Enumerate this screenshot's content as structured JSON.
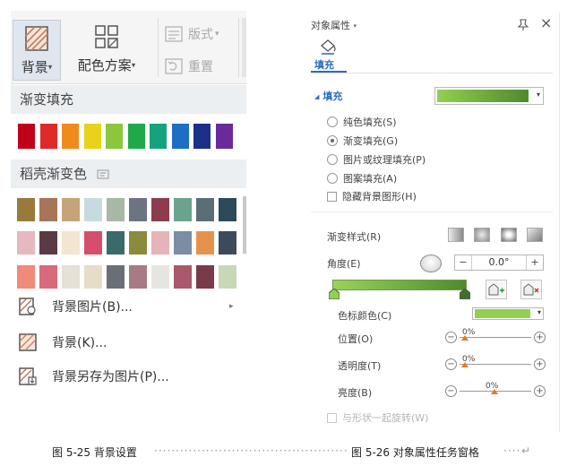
{
  "ribbon": {
    "background_btn": {
      "label": "背景",
      "icon": "background-hatch-icon"
    },
    "color_scheme_btn": {
      "label": "配色方案",
      "icon": "color-scheme-grid-icon"
    },
    "layout_btn": {
      "label": "版式",
      "icon": "layout-icon"
    },
    "reset_btn": {
      "label": "重置",
      "icon": "reset-icon"
    }
  },
  "gradient_section": {
    "title": "渐变填充",
    "colors": [
      "#c0001a",
      "#e02a2a",
      "#f08a1a",
      "#e8d21a",
      "#8cc63c",
      "#1faa4a",
      "#14a37c",
      "#1c6fc4",
      "#1d2f86",
      "#6a2a9c"
    ]
  },
  "shell_section": {
    "title": "稻壳渐变色",
    "row1": [
      "#9a7a3c",
      "#a8745a",
      "#c6a47a",
      "#c6dbe0",
      "#a8b8a6",
      "#6c7484",
      "#8c3c4a",
      "#6aa48e",
      "#5a6e76",
      "#2c4a5a"
    ],
    "row2": [
      "#e6b8c0",
      "#5c3a44",
      "#f2e6d0",
      "#d64e6a",
      "#3a6a6a",
      "#8c8a3c",
      "#e6b4b8",
      "#7c8ca6",
      "#e6924c",
      "#3c4a5c"
    ],
    "row3": [
      "#f08a7a",
      "#d86a7a",
      "#e6e0d6",
      "#e6dcc8",
      "#6a6e76",
      "#a87a84",
      "#e6e6e0",
      "#a85a6a",
      "#7a3a4a",
      "#c6d8b6"
    ]
  },
  "menu": {
    "bg_image": "背景图片(B)...",
    "bg": "背景(K)...",
    "save_as_image": "背景另存为图片(P)..."
  },
  "pane": {
    "title": "对象属性",
    "tab": "填充",
    "fill_label": "填充",
    "fill_options": [
      "纯色填充(S)",
      "渐变填充(G)",
      "图片或纹理填充(P)",
      "图案填充(A)"
    ],
    "selected_option": 1,
    "hide_bg": "隐藏背景图形(H)",
    "gradient_style": "渐变样式(R)",
    "angle_label": "角度(E)",
    "angle_minus": "−",
    "angle_value": "0.0°",
    "angle_plus": "+",
    "stop_color_label": "色标颜色(C)",
    "stop_color": "#92d050",
    "position_label": "位置(O)",
    "position_value": "0%",
    "transparency_label": "透明度(T)",
    "transparency_value": "0%",
    "brightness_label": "亮度(B)",
    "brightness_value": "0%",
    "minus_glyph": "−",
    "plus_glyph": "+",
    "rotate_with_shape": "与形状一起旋转(W)"
  },
  "captions": {
    "left": "图 5-25 背景设置",
    "right": "图 5-26 对象属性任务窗格",
    "dots": "··········································································",
    "return_glyph": "↵"
  }
}
